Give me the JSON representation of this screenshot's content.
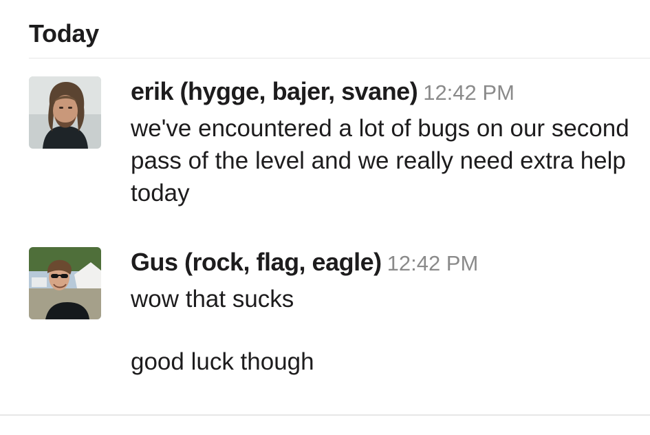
{
  "day_header": "Today",
  "messages": [
    {
      "author": "erik (hygge, bajer, svane)",
      "timestamp": "12:42 PM",
      "lines": [
        "we've encountered a lot of bugs on our second pass of the level and we really need extra help today"
      ]
    },
    {
      "author": "Gus (rock, flag, eagle)",
      "timestamp": "12:42 PM",
      "lines": [
        "wow that sucks",
        "good luck though"
      ]
    }
  ],
  "colors": {
    "text": "#1d1c1d",
    "timestamp": "#8a8a8a",
    "divider": "#e6e6e6"
  }
}
